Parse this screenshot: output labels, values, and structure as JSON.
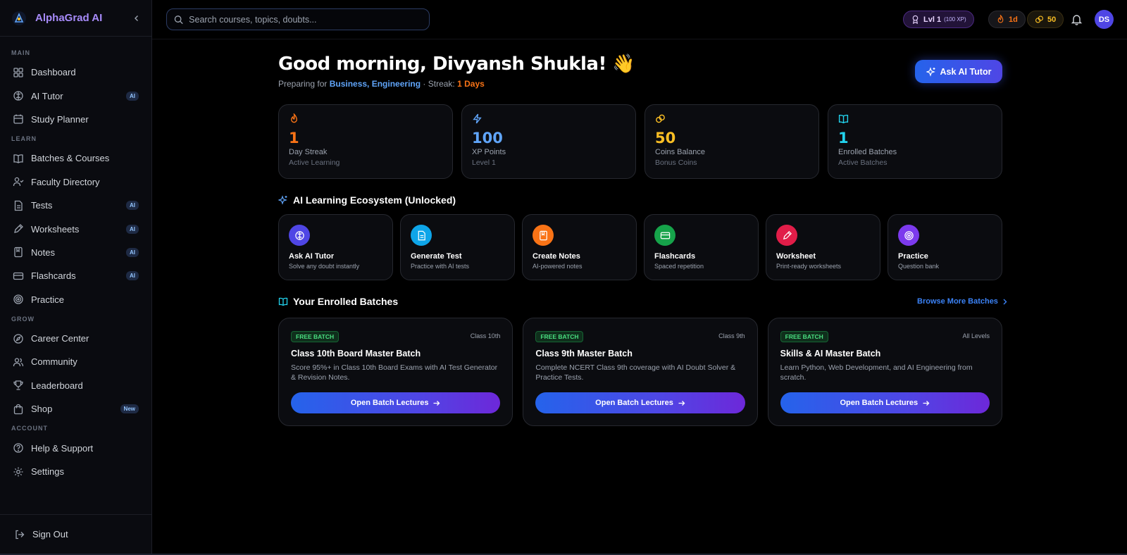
{
  "brand": {
    "name": "AlphaGrad AI"
  },
  "sidebar": {
    "sections": {
      "main": "MAIN",
      "learn": "LEARN",
      "grow": "GROW",
      "account": "ACCOUNT"
    },
    "items": {
      "dashboard": "Dashboard",
      "ai_tutor": "AI Tutor",
      "study_planner": "Study Planner",
      "batches": "Batches & Courses",
      "faculty": "Faculty Directory",
      "tests": "Tests",
      "worksheets": "Worksheets",
      "notes": "Notes",
      "flashcards": "Flashcards",
      "practice": "Practice",
      "career": "Career Center",
      "community": "Community",
      "leaderboard": "Leaderboard",
      "shop": "Shop",
      "help": "Help & Support",
      "settings": "Settings"
    },
    "badges": {
      "ai": "AI",
      "new": "New"
    },
    "sign_out": "Sign Out"
  },
  "header": {
    "search_placeholder": "Search courses, topics, doubts...",
    "level": "Lvl 1",
    "level_xp": "(100 XP)",
    "streak": "1d",
    "coins": "50",
    "avatar_initials": "DS"
  },
  "greeting": {
    "title": "Good morning, Divyansh Shukla! 👋",
    "preparing_prefix": "Preparing for ",
    "exams": "Business, Engineering",
    "streak_prefix": " · Streak: ",
    "streak_value": "1 Days",
    "ask_button": "Ask AI Tutor"
  },
  "stats": [
    {
      "value": "1",
      "label": "Day Streak",
      "sub": "Active Learning",
      "color": "#f97316",
      "icon": "flame-icon"
    },
    {
      "value": "100",
      "label": "XP Points",
      "sub": "Level 1",
      "color": "#60a5fa",
      "icon": "bolt-icon"
    },
    {
      "value": "50",
      "label": "Coins Balance",
      "sub": "Bonus Coins",
      "color": "#fbbf24",
      "icon": "coins-icon"
    },
    {
      "value": "1",
      "label": "Enrolled Batches",
      "sub": "Active Batches",
      "color": "#22d3ee",
      "icon": "book-icon"
    }
  ],
  "ecosystem": {
    "title": "AI Learning Ecosystem (Unlocked)",
    "tools": [
      {
        "title": "Ask AI Tutor",
        "desc": "Solve any doubt instantly",
        "color": "#4f46e5",
        "icon": "brain-icon"
      },
      {
        "title": "Generate Test",
        "desc": "Practice with AI tests",
        "color": "#0ea5e9",
        "icon": "document-icon"
      },
      {
        "title": "Create Notes",
        "desc": "AI-powered notes",
        "color": "#f97316",
        "icon": "notebook-icon"
      },
      {
        "title": "Flashcards",
        "desc": "Spaced repetition",
        "color": "#16a34a",
        "icon": "card-icon"
      },
      {
        "title": "Worksheet",
        "desc": "Print-ready worksheets",
        "color": "#e11d48",
        "icon": "pen-icon"
      },
      {
        "title": "Practice",
        "desc": "Question bank",
        "color": "#7c3aed",
        "icon": "target-icon"
      }
    ]
  },
  "batches": {
    "title": "Your Enrolled Batches",
    "browse": "Browse More Batches",
    "items": [
      {
        "badge": "FREE BATCH",
        "level": "Class 10th",
        "title": "Class 10th Board Master Batch",
        "desc": "Score 95%+ in Class 10th Board Exams with AI Test Generator & Revision Notes.",
        "button": "Open Batch Lectures"
      },
      {
        "badge": "FREE BATCH",
        "level": "Class 9th",
        "title": "Class 9th Master Batch",
        "desc": "Complete NCERT Class 9th coverage with AI Doubt Solver & Practice Tests.",
        "button": "Open Batch Lectures"
      },
      {
        "badge": "FREE BATCH",
        "level": "All Levels",
        "title": "Skills & AI Master Batch",
        "desc": "Learn Python, Web Development, and AI Engineering from scratch.",
        "button": "Open Batch Lectures"
      }
    ]
  }
}
